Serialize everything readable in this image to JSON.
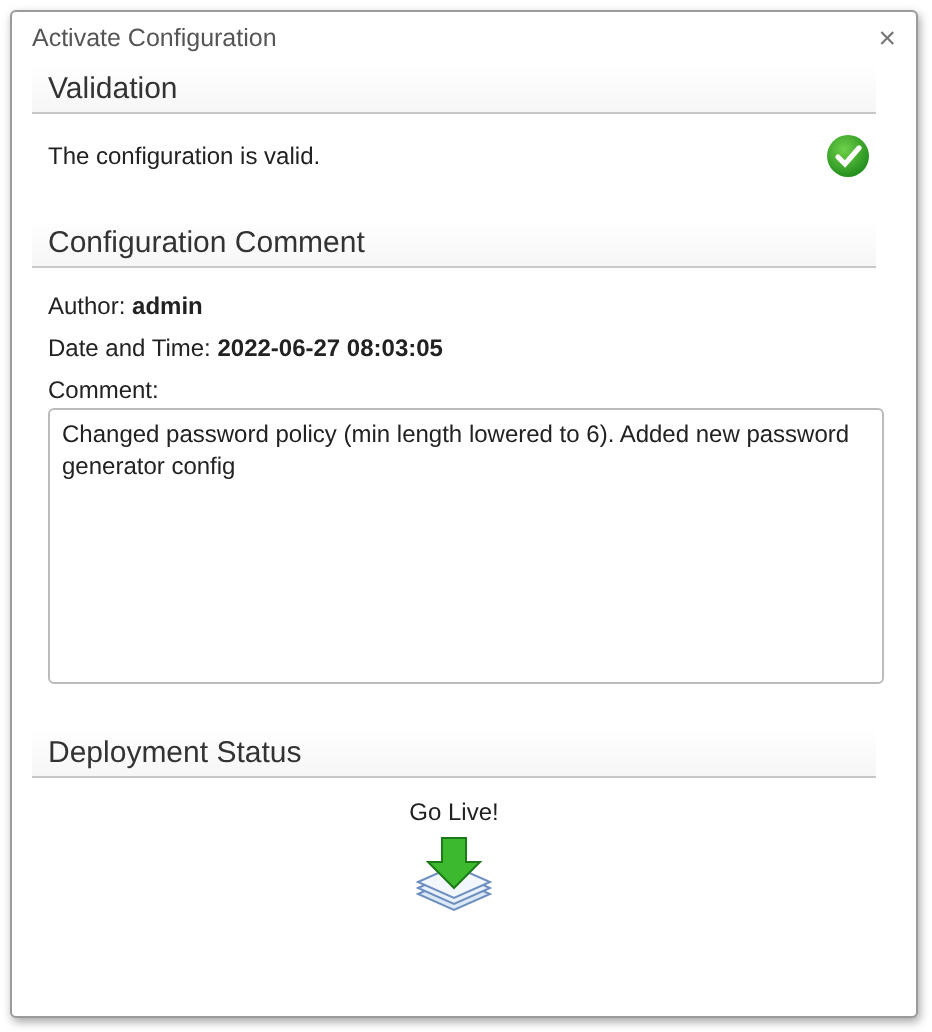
{
  "window": {
    "title": "Activate Configuration",
    "close": "×"
  },
  "validation": {
    "heading": "Validation",
    "message": "The configuration is valid.",
    "valid": true
  },
  "comment_section": {
    "heading": "Configuration Comment",
    "author_label": "Author:",
    "author": "admin",
    "date_label": "Date and Time:",
    "date": "2022-06-27 08:03:05",
    "comment_label": "Comment:",
    "comment": "Changed password policy (min length lowered to 6). Added new password generator config"
  },
  "deployment": {
    "heading": "Deployment Status",
    "action": "Go Live!"
  }
}
